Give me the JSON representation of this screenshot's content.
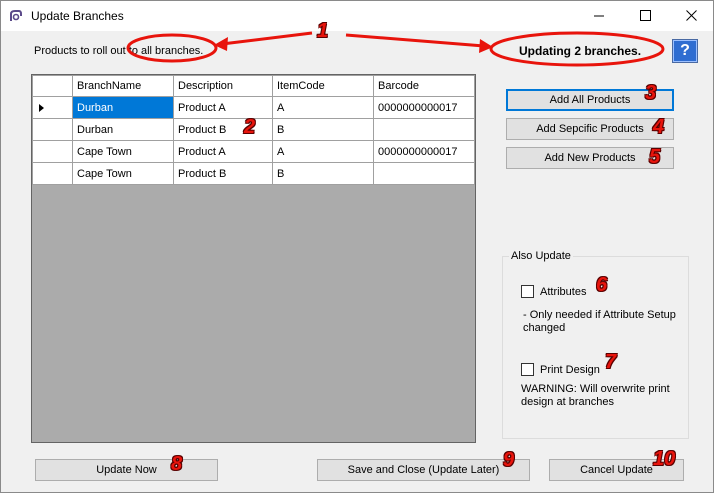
{
  "window": {
    "title": "Update Branches",
    "controls": {
      "minimize": "—",
      "maximize": "☐",
      "close": "✕"
    }
  },
  "header": {
    "rollout_label": "Products to roll out to all branches.",
    "updating_label": "Updating 2 branches.",
    "help_label": "?"
  },
  "grid": {
    "columns": [
      "BranchName",
      "Description",
      "ItemCode",
      "Barcode"
    ],
    "rows": [
      {
        "branch": "Durban",
        "description": "Product A",
        "item_code": "A",
        "barcode": "0000000000017",
        "current": true
      },
      {
        "branch": "Durban",
        "description": "Product B",
        "item_code": "B",
        "barcode": ""
      },
      {
        "branch": "Cape Town",
        "description": "Product A",
        "item_code": "A",
        "barcode": "0000000000017"
      },
      {
        "branch": "Cape Town",
        "description": "Product B",
        "item_code": "B",
        "barcode": ""
      }
    ]
  },
  "buttons": {
    "add_all": "Add All Products",
    "add_specific": "Add Sepcific Products",
    "add_new": "Add New Products",
    "update_now": "Update Now",
    "save_close": "Save and Close (Update Later)",
    "cancel": "Cancel Update"
  },
  "also_update": {
    "title": "Also Update",
    "attributes_label": "Attributes",
    "attributes_checked": false,
    "attributes_note": "- Only needed if Attribute Setup changed",
    "print_label": "Print Design",
    "print_checked": false,
    "print_warning": "WARNING: Will overwrite print design at branches"
  },
  "annotations": [
    "1",
    "2",
    "3",
    "4",
    "5",
    "6",
    "7",
    "8",
    "9",
    "10"
  ],
  "colors": {
    "window_bg": "#f0f0f0",
    "selection": "#0078d7",
    "grid_bg": "#ababab",
    "annotation_red": "#e8140c",
    "help_blue": "#2f6dd1"
  }
}
